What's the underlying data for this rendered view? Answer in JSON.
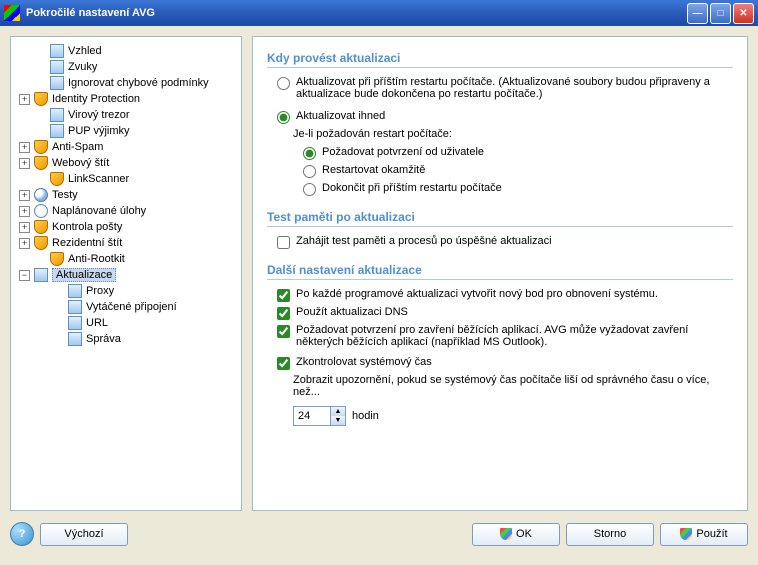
{
  "window": {
    "title": "Pokročilé nastavení AVG"
  },
  "tree": [
    {
      "label": "Vzhled",
      "level": 1,
      "exp": "none",
      "icon": "page"
    },
    {
      "label": "Zvuky",
      "level": 1,
      "exp": "none",
      "icon": "page"
    },
    {
      "label": "Ignorovat chybové podmínky",
      "level": 1,
      "exp": "none",
      "icon": "page"
    },
    {
      "label": "Identity Protection",
      "level": 0,
      "exp": "plus",
      "icon": "shield"
    },
    {
      "label": "Virový trezor",
      "level": 1,
      "exp": "none",
      "icon": "page"
    },
    {
      "label": "PUP výjimky",
      "level": 1,
      "exp": "none",
      "icon": "page"
    },
    {
      "label": "Anti-Spam",
      "level": 0,
      "exp": "plus",
      "icon": "shield"
    },
    {
      "label": "Webový štít",
      "level": 0,
      "exp": "plus",
      "icon": "shield"
    },
    {
      "label": "LinkScanner",
      "level": 1,
      "exp": "none",
      "icon": "shield"
    },
    {
      "label": "Testy",
      "level": 0,
      "exp": "plus",
      "icon": "mag"
    },
    {
      "label": "Naplánované úlohy",
      "level": 0,
      "exp": "plus",
      "icon": "clock"
    },
    {
      "label": "Kontrola pošty",
      "level": 0,
      "exp": "plus",
      "icon": "shield"
    },
    {
      "label": "Rezidentní štít",
      "level": 0,
      "exp": "plus",
      "icon": "shield"
    },
    {
      "label": "Anti-Rootkit",
      "level": 1,
      "exp": "none",
      "icon": "shield"
    },
    {
      "label": "Aktualizace",
      "level": 0,
      "exp": "minus",
      "icon": "page",
      "selected": true
    },
    {
      "label": "Proxy",
      "level": 2,
      "exp": "none",
      "icon": "page"
    },
    {
      "label": "Vytáčené připojení",
      "level": 2,
      "exp": "none",
      "icon": "page"
    },
    {
      "label": "URL",
      "level": 2,
      "exp": "none",
      "icon": "page"
    },
    {
      "label": "Správa",
      "level": 2,
      "exp": "none",
      "icon": "page"
    }
  ],
  "sections": {
    "when": {
      "title": "Kdy provést aktualizaci",
      "opt_next_restart": "Aktualizovat při příštím restartu počítače. (Aktualizované soubory budou připraveny a aktualizace bude dokončena po restartu počítače.)",
      "opt_immediate": "Aktualizovat ihned",
      "restart_label": "Je-li požadován restart počítače:",
      "restart_confirm": "Požadovat potvrzení od uživatele",
      "restart_now": "Restartovat okamžitě",
      "restart_next": "Dokončit při příštím restartu počítače"
    },
    "memtest": {
      "title": "Test paměti po aktualizaci",
      "chk": "Zahájit test paměti a procesů po úspěšné aktualizaci"
    },
    "other": {
      "title": "Další nastavení aktualizace",
      "chk_restore": "Po každé programové aktualizaci vytvořit nový bod pro obnovení systému.",
      "chk_dns": "Použít aktualizaci DNS",
      "chk_close": "Požadovat potvrzení pro zavření běžících aplikací. AVG může vyžadovat zavření některých běžících aplikací (například MS Outlook).",
      "chk_time": "Zkontrolovat systémový čas",
      "time_text": "Zobrazit upozornění, pokud se systémový čas počítače liší od správného času o více, než...",
      "time_value": "24",
      "time_unit": "hodin"
    }
  },
  "footer": {
    "help": "?",
    "default": "Výchozí",
    "ok": "OK",
    "cancel": "Storno",
    "apply": "Použít"
  }
}
